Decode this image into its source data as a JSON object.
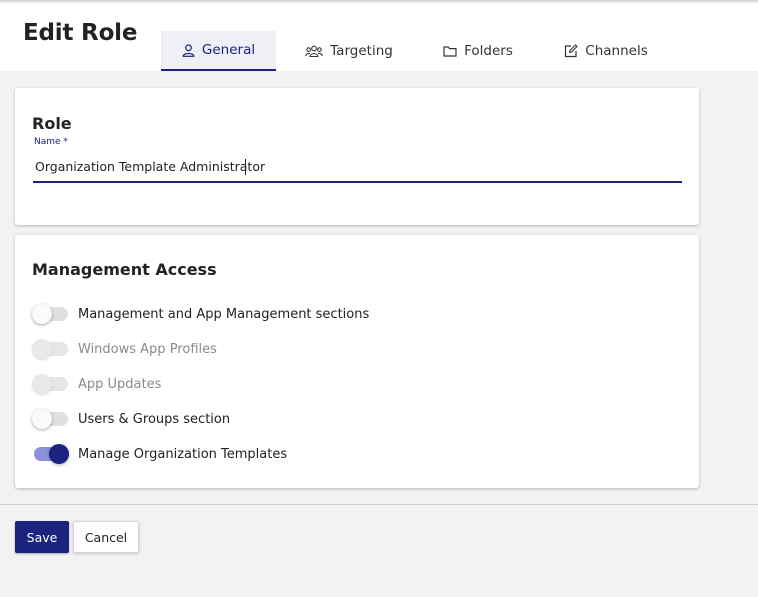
{
  "header": {
    "title": "Edit Role",
    "tabs": [
      {
        "label": "General",
        "icon": "person-icon",
        "active": true
      },
      {
        "label": "Targeting",
        "icon": "group-icon",
        "active": false
      },
      {
        "label": "Folders",
        "icon": "folder-icon",
        "active": false
      },
      {
        "label": "Channels",
        "icon": "edit-icon",
        "active": false
      }
    ]
  },
  "role_card": {
    "title": "Role",
    "name_label": "Name *",
    "name_value": "Organization Template Administrator"
  },
  "access_card": {
    "title": "Management Access",
    "toggles": [
      {
        "label": "Management and App Management sections",
        "state": "off",
        "enabled": true
      },
      {
        "label": "Windows App Profiles",
        "state": "off",
        "enabled": false
      },
      {
        "label": "App Updates",
        "state": "off",
        "enabled": false
      },
      {
        "label": "Users & Groups section",
        "state": "off",
        "enabled": true
      },
      {
        "label": "Manage Organization Templates",
        "state": "on",
        "enabled": true
      }
    ]
  },
  "footer": {
    "save_label": "Save",
    "cancel_label": "Cancel"
  },
  "colors": {
    "accent": "#1a237e",
    "toggle_track_on": "#8c90d8",
    "background": "#f2f2f2"
  }
}
